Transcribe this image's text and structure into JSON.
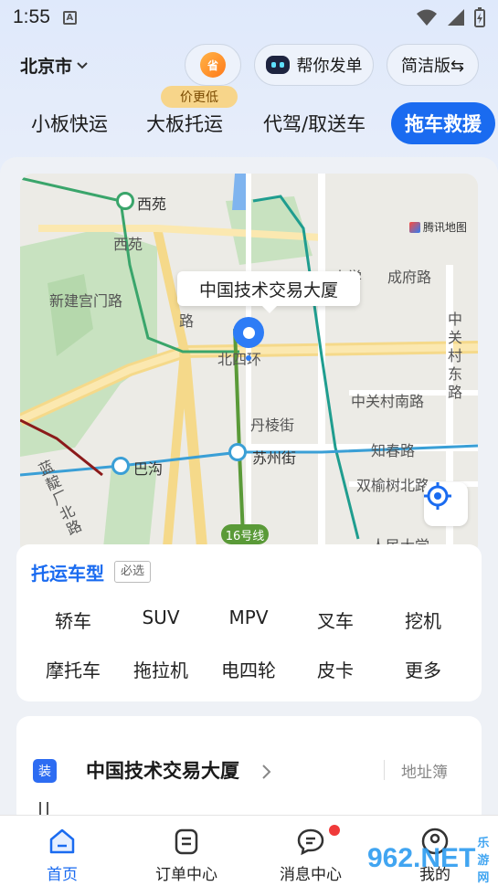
{
  "status_bar": {
    "time": "1:55",
    "notif_icon": "A"
  },
  "header": {
    "city": "北京市",
    "save_badge": "省",
    "help_label": "帮你发单",
    "simple_label": "简洁版⇆"
  },
  "tabs": [
    {
      "label": "小板快运"
    },
    {
      "label": "大板托运"
    },
    {
      "label": "代驾/取送车"
    },
    {
      "label": "拖车救援"
    }
  ],
  "price_tag": "价更低",
  "map": {
    "callout": "中国技术交易大厦",
    "provider": "腾讯地图",
    "line_badge": "16号线",
    "labels": {
      "xiyuan_station": "西苑",
      "xiyuan": "西苑",
      "xinjian": "新建宫门路",
      "lu": "路",
      "daxue": "大学",
      "chengfu": "成府路",
      "zhongguancun_east": "中关村东路",
      "beisihuan": "北四环",
      "zhongguancun_south": "中关村南路",
      "danleng": "丹棱街",
      "suzhou": "苏州街",
      "zhichun": "知春路",
      "bagou": "巴沟",
      "shuangyu": "双榆树北路",
      "landian": "蓝靛厂北路",
      "renmin": "人民大学"
    }
  },
  "vehicle_types": {
    "title": "托运车型",
    "required": "必选",
    "items": [
      "轿车",
      "SUV",
      "MPV",
      "叉车",
      "挖机",
      "摩托车",
      "拖拉机",
      "电四轮",
      "皮卡",
      "更多"
    ]
  },
  "address": {
    "badge": "装",
    "name": "中国技术交易大厦",
    "book": "地址簿"
  },
  "bottom_nav": [
    {
      "label": "首页"
    },
    {
      "label": "订单中心"
    },
    {
      "label": "消息中心"
    },
    {
      "label": "我的"
    }
  ],
  "watermark": {
    "brand": "962.NET",
    "sub": "乐游网"
  }
}
